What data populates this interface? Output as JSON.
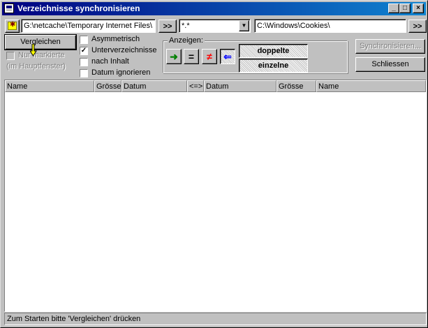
{
  "window": {
    "title": "Verzeichnisse synchronisieren",
    "minimize_glyph": "_",
    "maximize_glyph": "□",
    "close_glyph": "×"
  },
  "toolbar": {
    "left_path": "G:\\netcache\\Temporary Internet Files\\",
    "left_browse": ">>",
    "filter_value": "*.*",
    "right_path": "C:\\Windows\\Cookies\\",
    "right_browse": ">>"
  },
  "actions": {
    "compare": "Vergleichen",
    "synchronize": "Synchronisieren...",
    "close": "Schliessen"
  },
  "options": {
    "only_marked": "Nur markierte",
    "only_marked_sub": "(im Hauptfenster)",
    "asymmetric": "Asymmetrisch",
    "asymmetric_checked": false,
    "subdirectories": "Unterverzeichnisse",
    "subdirectories_checked": true,
    "by_content": "nach Inhalt",
    "by_content_checked": false,
    "ignore_date": "Datum ignorieren",
    "ignore_date_checked": false,
    "check_glyph": "✓"
  },
  "display": {
    "group_label": "Anzeigen:",
    "right_arrow_glyph": "➜",
    "equal_glyph": "=",
    "not_equal_glyph": "≠",
    "left_arrow_glyph": "⇐",
    "duplicates": "doppelte",
    "singles": "einzelne"
  },
  "list": {
    "columns": [
      "Name",
      "Grösse",
      "Datum",
      "<=>",
      "Datum",
      "Grösse",
      "Name"
    ],
    "rows": []
  },
  "status": {
    "text": "Zum Starten bitte 'Vergleichen' drücken"
  },
  "colors": {
    "titlebar_start": "#000080",
    "titlebar_end": "#1084d0",
    "face": "#c0c0c0",
    "green_arrow": "#008000",
    "red_not_equal": "#ff0000",
    "blue_arrow": "#0000ff"
  }
}
